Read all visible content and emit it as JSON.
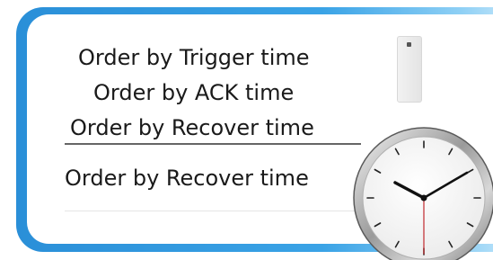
{
  "order_menu": {
    "options": [
      "Order by Trigger time",
      "Order by ACK time",
      "Order by Recover time"
    ],
    "selected": "Order by Recover time"
  },
  "icons": {
    "clock": "clock-icon",
    "scroll": "scrollbar-thumb-icon"
  },
  "colors": {
    "frame_accent": "#2a8fd8",
    "second_hand": "#c0282d"
  }
}
